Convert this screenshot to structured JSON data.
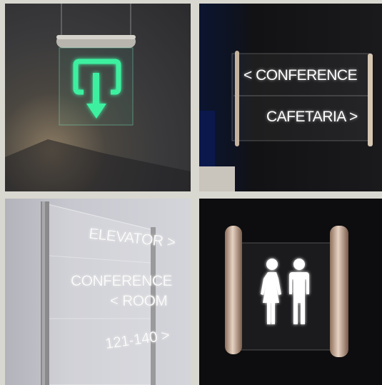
{
  "panels": [
    {
      "id": "exit-sign"
    },
    {
      "id": "directional-sign",
      "lines": {
        "line1": "< CONFERENCE",
        "line2": "CAFETARIA >"
      }
    },
    {
      "id": "directory-sign",
      "lines": {
        "line1": "ELEVATOR >",
        "line2": "CONFERENCE",
        "line3": "< ROOM",
        "line4": "121-140 >"
      }
    },
    {
      "id": "restroom-sign",
      "icons": [
        "female-person-icon",
        "male-person-icon"
      ]
    }
  ],
  "colors": {
    "exit_green": "#3ef0a0",
    "glow_white": "#ffffff",
    "frame": "#d9d8d0"
  }
}
